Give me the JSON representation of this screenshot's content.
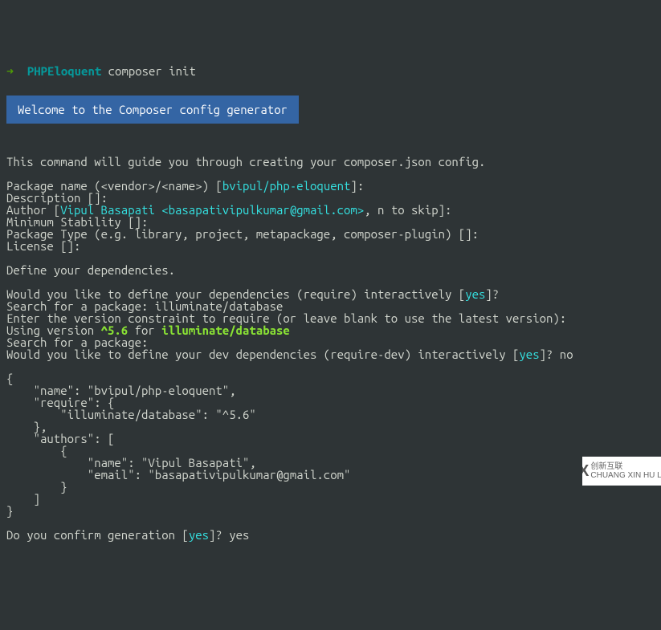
{
  "prompt": {
    "arrow": "➜",
    "dir": "PHPEloquent",
    "cmd": "composer init"
  },
  "welcome": "Welcome to the Composer config generator",
  "intro": "This command will guide you through creating your composer.json config.",
  "pkg": {
    "label_pre": "Package name (<vendor>/<name>) [",
    "default": "bvipul/php-eloquent",
    "label_post": "]:"
  },
  "desc": "Description []:",
  "author": {
    "label_pre": "Author [",
    "value": "Vipul Basapati <basapativipulkumar@gmail.com>",
    "label_post": ", n to skip]:"
  },
  "minstab": "Minimum Stability []:",
  "ptype": "Package Type (e.g. library, project, metapackage, composer-plugin) []:",
  "license": "License []:",
  "definedeps": "Define your dependencies.",
  "req_q": {
    "pre": "Would you like to define your dependencies (require) interactively [",
    "yes": "yes",
    "post": "]?"
  },
  "search1": "Search for a package: illuminate/database",
  "ver_q": "Enter the version constraint to require (or leave blank to use the latest version):",
  "using": {
    "pre": "Using version ",
    "ver": "^5.6",
    "mid": " for ",
    "pkg": "illuminate/database"
  },
  "search2": "Search for a package:",
  "reqdev_q": {
    "pre": "Would you like to define your dev dependencies (require-dev) interactively [",
    "yes": "yes",
    "post": "]? no"
  },
  "json_block": "{\n    \"name\": \"bvipul/php-eloquent\",\n    \"require\": {\n        \"illuminate/database\": \"^5.6\"\n    },\n    \"authors\": [\n        {\n            \"name\": \"Vipul Basapati\",\n            \"email\": \"basapativipulkumar@gmail.com\"\n        }\n    ]\n}",
  "confirm": {
    "pre": "Do you confirm generation [",
    "yes": "yes",
    "post": "]? yes"
  },
  "logo": {
    "cx": "CX",
    "line1": "创新互联",
    "line2": "CHUANG XIN HU LIAN"
  }
}
